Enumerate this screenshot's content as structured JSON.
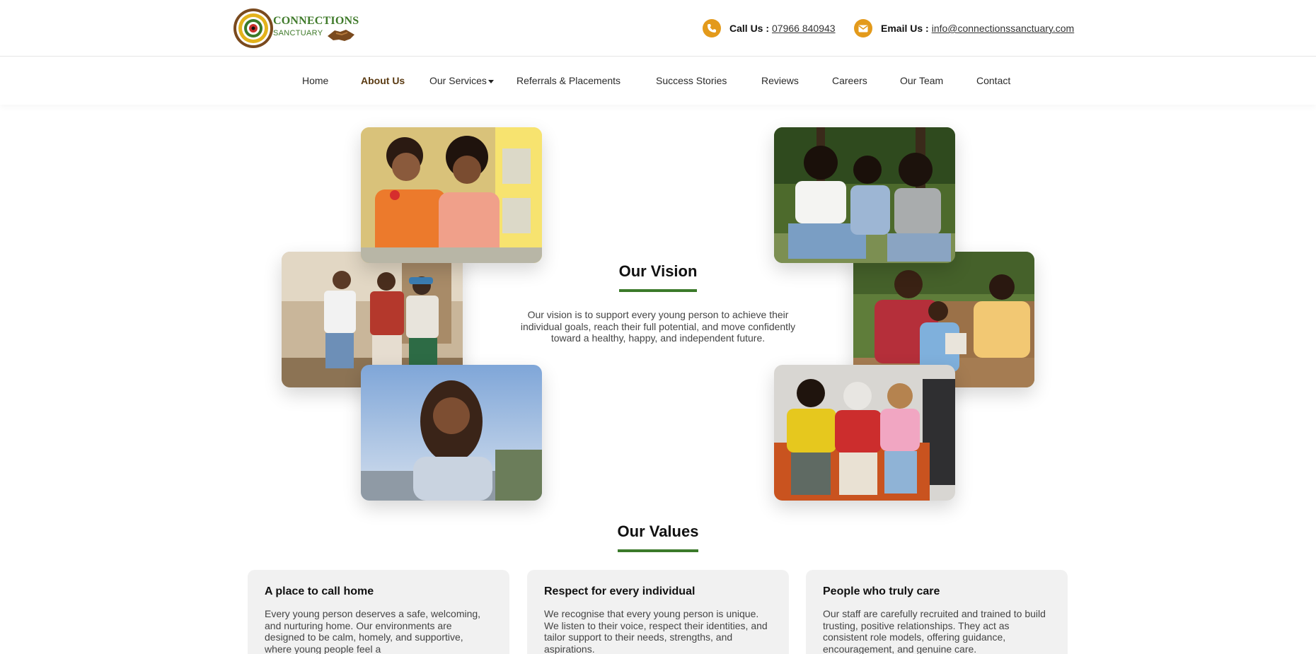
{
  "brand": {
    "name_line1": "CONNECTIONS",
    "name_line2": "SANCTUARY",
    "colors": {
      "green": "#3b7a2a",
      "orange": "#e39a1b",
      "brown": "#7a4a1e"
    }
  },
  "contact": {
    "phone_label": "Call Us :",
    "phone_value": "07966 840943",
    "email_label": "Email Us :",
    "email_value": "info@connectionssanctuary.com"
  },
  "nav": {
    "items": [
      {
        "label": "Home"
      },
      {
        "label": "About Us",
        "active": true
      },
      {
        "label": "Our Services",
        "has_dropdown": true
      },
      {
        "label": "Referrals & Placements"
      },
      {
        "label": "Success Stories"
      },
      {
        "label": "Reviews"
      },
      {
        "label": "Careers"
      },
      {
        "label": "Our Team"
      },
      {
        "label": "Contact"
      }
    ]
  },
  "vision": {
    "title": "Our Vision",
    "text": "Our vision is to support every young person to achieve their individual goals, reach their full potential, and move confidently toward a healthy, happy, and independent future."
  },
  "photos": [
    {
      "name": "photo-two-girls-smiling"
    },
    {
      "name": "photo-friends-street"
    },
    {
      "name": "photo-girl-laughing"
    },
    {
      "name": "photo-girls-in-park"
    },
    {
      "name": "photo-family-crafting"
    },
    {
      "name": "photo-friends-gaming"
    }
  ],
  "values": {
    "title": "Our Values",
    "cards": [
      {
        "title": "A place to call home",
        "text": "Every young person deserves a safe, welcoming, and nurturing home. Our environments are designed to be calm, homely, and supportive, where young people feel a"
      },
      {
        "title": "Respect for every individual",
        "text": "We recognise that every young person is unique. We listen to their voice, respect their identities, and tailor support to their needs, strengths, and aspirations."
      },
      {
        "title": "People who truly care",
        "text": "Our staff are carefully recruited and trained to build trusting, positive relationships. They act as consistent role models, offering guidance, encouragement, and genuine care."
      }
    ]
  }
}
